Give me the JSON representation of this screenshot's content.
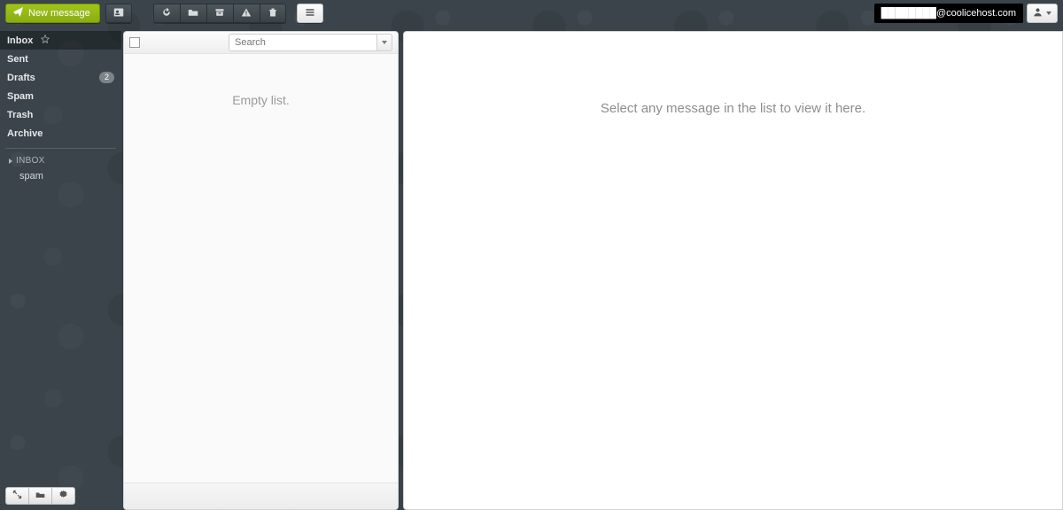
{
  "toolbar": {
    "new_message_label": "New message"
  },
  "account": {
    "email": "████████@coolicehost.com"
  },
  "sidebar": {
    "folders": [
      {
        "label": "Inbox",
        "active": true,
        "starred": true
      },
      {
        "label": "Sent",
        "active": false
      },
      {
        "label": "Drafts",
        "active": false,
        "badge": "2"
      },
      {
        "label": "Spam",
        "active": false
      },
      {
        "label": "Trash",
        "active": false
      },
      {
        "label": "Archive",
        "active": false
      }
    ],
    "tree_header": "INBOX",
    "subfolders": [
      {
        "label": "spam"
      }
    ]
  },
  "list": {
    "search_placeholder": "Search",
    "empty_text": "Empty list."
  },
  "reader": {
    "placeholder": "Select any message in the list to view it here."
  }
}
